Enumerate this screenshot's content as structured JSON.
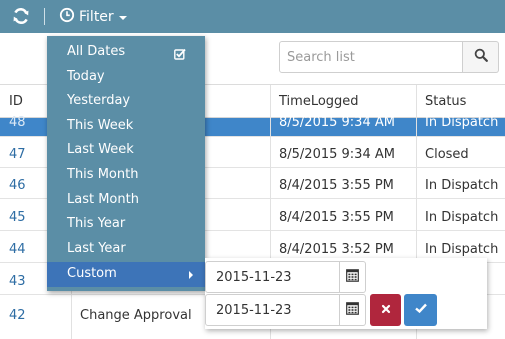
{
  "toolbar": {
    "filter_label": "Filter",
    "refresh_icon": "refresh-icon",
    "clock_icon": "clock-icon"
  },
  "search": {
    "placeholder": "Search list",
    "icon": "search-icon"
  },
  "table": {
    "columns": [
      "ID",
      "",
      "TimeLogged",
      "Status"
    ],
    "rows": [
      {
        "id": "48",
        "subject": "",
        "time": "8/5/2015 9:34 AM",
        "status": "In Dispatch",
        "selected": true
      },
      {
        "id": "47",
        "subject": "",
        "time": "8/5/2015 9:34 AM",
        "status": "Closed"
      },
      {
        "id": "46",
        "subject": "",
        "time": "8/4/2015 3:55 PM",
        "status": "In Dispatch"
      },
      {
        "id": "45",
        "subject": "",
        "time": "8/4/2015 3:55 PM",
        "status": "In Dispatch"
      },
      {
        "id": "44",
        "subject": "",
        "time": "8/4/2015 3:52 PM",
        "status": "In Dispatch"
      },
      {
        "id": "43",
        "subject": "",
        "time": "",
        "status": ""
      },
      {
        "id": "42",
        "subject": "Change Approval",
        "time": "",
        "status": ""
      }
    ]
  },
  "filter_menu": {
    "items": [
      "All Dates",
      "Today",
      "Yesterday",
      "This Week",
      "Last Week",
      "This Month",
      "Last Month",
      "This Year",
      "Last Year",
      "Custom"
    ],
    "checked_item": "All Dates",
    "active_item": "Custom"
  },
  "custom_range": {
    "from": "2015-11-23",
    "to": "2015-11-23",
    "cancel_icon": "close-icon",
    "apply_icon": "check-icon"
  },
  "colors": {
    "toolbar": "#5b8ea6",
    "menu": "#5b8ea6",
    "menu_active": "#3d74b8",
    "selected_row": "#3f86c9",
    "cancel": "#b0263d",
    "apply": "#3f86c9",
    "link": "#2e6da4"
  }
}
